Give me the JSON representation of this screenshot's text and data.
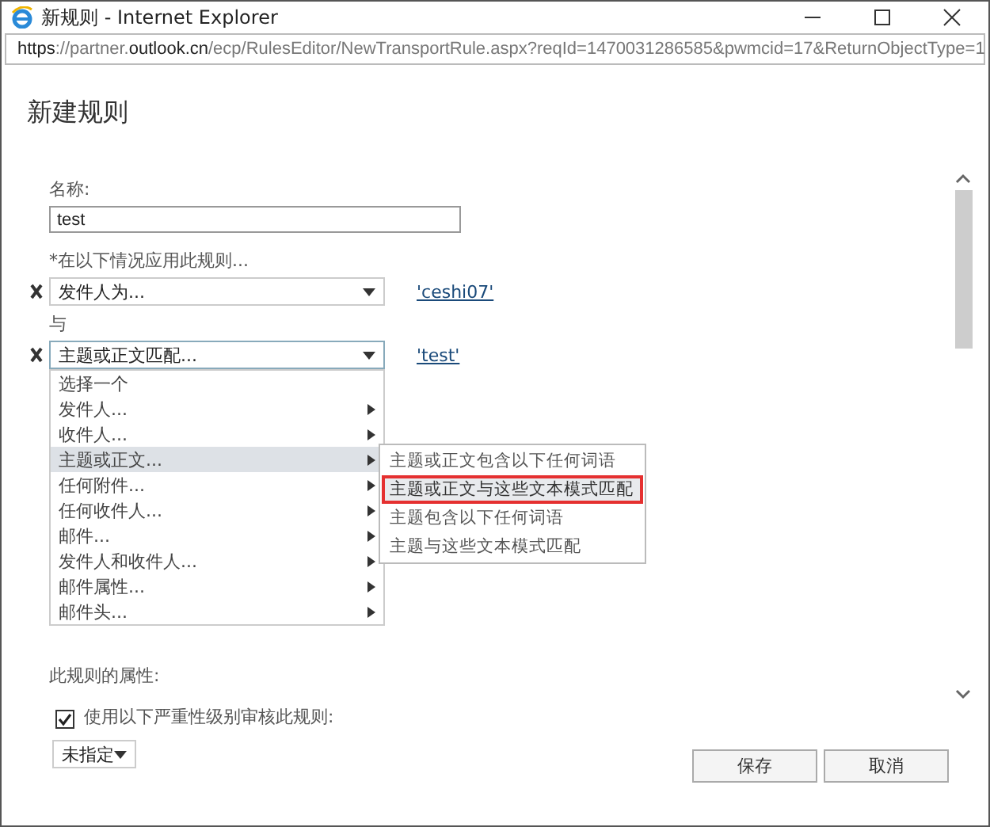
{
  "window": {
    "title": "新规则 - Internet Explorer"
  },
  "address_bar": {
    "url": "**https**://partner.**outlook.cn**/ecp/RulesEditor/NewTransportRule.aspx?reqId=1470031286585&pwmcid=17&ReturnObjectType=1"
  },
  "heading": "新建规则",
  "name_label": "名称:",
  "name_value": "test",
  "conditions_label": "*在以下情况应用此规则...",
  "conditions": [
    {
      "value": "发件人为...",
      "link": "'ceshi07'",
      "open": false
    },
    {
      "value": "主题或正文匹配...",
      "link": "'test'",
      "open": true
    }
  ],
  "joiner": "与",
  "menu": {
    "items": [
      {
        "label": "选择一个",
        "submenu": false,
        "selected": false
      },
      {
        "label": "发件人...",
        "submenu": true,
        "selected": false
      },
      {
        "label": "收件人...",
        "submenu": true,
        "selected": false
      },
      {
        "label": "主题或正文...",
        "submenu": true,
        "selected": true
      },
      {
        "label": "任何附件...",
        "submenu": true,
        "selected": false
      },
      {
        "label": "任何收件人...",
        "submenu": true,
        "selected": false
      },
      {
        "label": "邮件...",
        "submenu": true,
        "selected": false
      },
      {
        "label": "发件人和收件人...",
        "submenu": true,
        "selected": false
      },
      {
        "label": "邮件属性...",
        "submenu": true,
        "selected": false
      },
      {
        "label": "邮件头...",
        "submenu": true,
        "selected": false
      }
    ]
  },
  "submenu": {
    "items": [
      {
        "label": "主题或正文包含以下任何词语",
        "selected": false
      },
      {
        "label": "主题或正文与这些文本模式匹配",
        "selected": true
      },
      {
        "label": "主题包含以下任何词语",
        "selected": false
      },
      {
        "label": "主题与这些文本模式匹配",
        "selected": false
      }
    ]
  },
  "properties_label": "此规则的属性:",
  "audit": {
    "label": "使用以下严重性级别审核此规则:",
    "checked": true
  },
  "severity": {
    "value": "未指定"
  },
  "buttons": [
    {
      "label": "保存"
    },
    {
      "label": "取消"
    }
  ]
}
